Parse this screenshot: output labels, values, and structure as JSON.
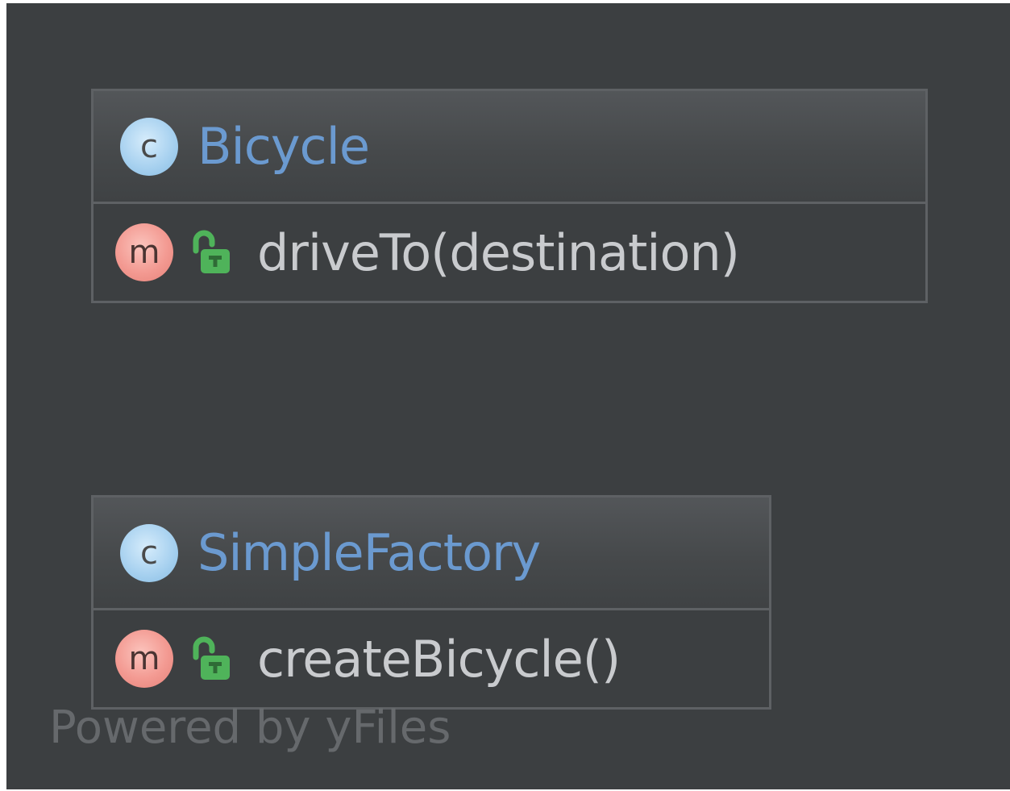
{
  "diagram": {
    "classes": [
      {
        "name": "Bicycle",
        "class_icon_letter": "c",
        "methods": [
          {
            "name": "driveTo(destination)",
            "icon_letter": "m",
            "visibility": "public"
          }
        ]
      },
      {
        "name": "SimpleFactory",
        "class_icon_letter": "c",
        "methods": [
          {
            "name": "createBicycle()",
            "icon_letter": "m",
            "visibility": "public"
          }
        ]
      }
    ],
    "watermark": "Powered by yFiles"
  },
  "colors": {
    "background": "#3c3f41",
    "class_name": "#6b9ad0",
    "method_name": "#c9cbce",
    "lock": "#4fb35a",
    "border": "#5e6164"
  },
  "icons": {
    "class": "class-c-icon",
    "method": "method-m-icon",
    "visibility": "public-unlocked-icon"
  }
}
